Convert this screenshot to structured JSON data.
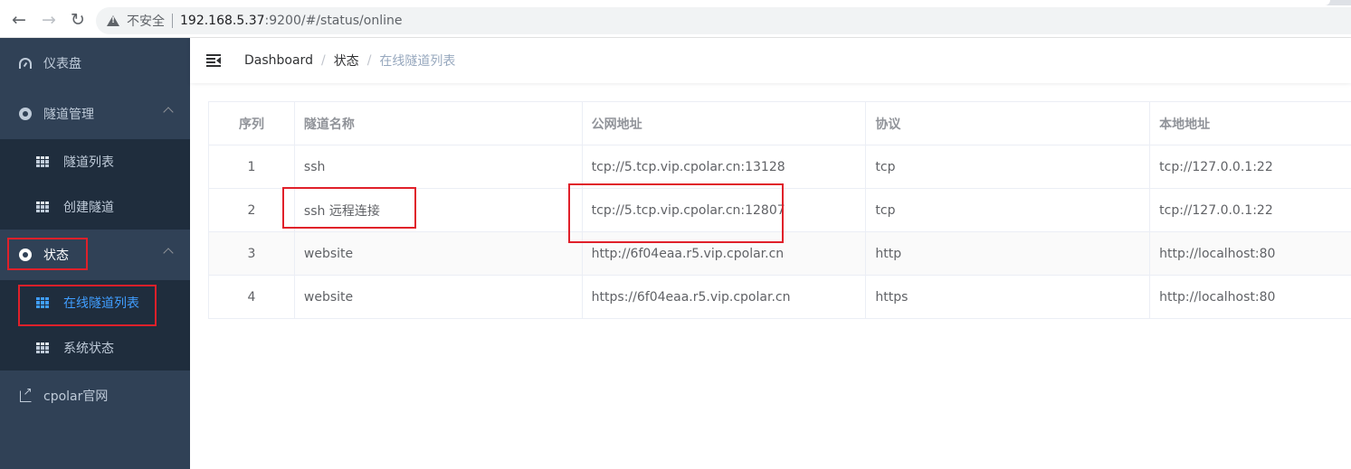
{
  "browser": {
    "insecure_label": "不安全",
    "url_host": "192.168.5.37",
    "url_rest": ":9200/#/status/online"
  },
  "sidebar": {
    "items": [
      {
        "label": "仪表盘",
        "icon": "dashboard-icon"
      },
      {
        "label": "隧道管理",
        "icon": "circle-icon",
        "children": [
          {
            "label": "隧道列表",
            "icon": "table-icon"
          },
          {
            "label": "创建隧道",
            "icon": "table-icon"
          }
        ]
      },
      {
        "label": "状态",
        "icon": "circle-icon",
        "children": [
          {
            "label": "在线隧道列表",
            "icon": "table-icon",
            "active": true
          },
          {
            "label": "系统状态",
            "icon": "table-icon"
          }
        ]
      },
      {
        "label": "cpolar官网",
        "icon": "external-link-icon"
      }
    ]
  },
  "breadcrumb": [
    "Dashboard",
    "状态",
    "在线隧道列表"
  ],
  "table": {
    "columns": [
      "序列",
      "隧道名称",
      "公网地址",
      "协议",
      "本地地址"
    ],
    "rows": [
      [
        "1",
        "ssh",
        "tcp://5.tcp.vip.cpolar.cn:13128",
        "tcp",
        "tcp://127.0.0.1:22"
      ],
      [
        "2",
        "ssh 远程连接",
        "tcp://5.tcp.vip.cpolar.cn:12807",
        "tcp",
        "tcp://127.0.0.1:22"
      ],
      [
        "3",
        "website",
        "http://6f04eaa.r5.vip.cpolar.cn",
        "http",
        "http://localhost:80"
      ],
      [
        "4",
        "website",
        "https://6f04eaa.r5.vip.cpolar.cn",
        "https",
        "http://localhost:80"
      ]
    ]
  },
  "colors": {
    "sidebar_bg": "#304156",
    "submenu_bg": "#1f2d3d",
    "active_text": "#409eff",
    "annotation_red": "#e0202a"
  }
}
